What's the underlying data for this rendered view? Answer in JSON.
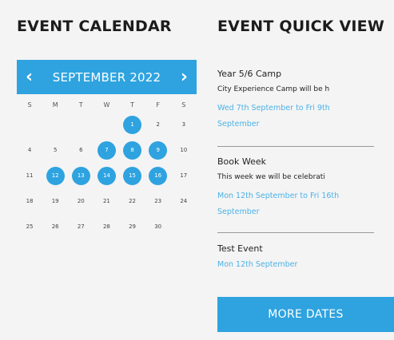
{
  "calendar": {
    "title": "EVENT CALENDAR",
    "prev_icon": "chevron-left-icon",
    "next_icon": "chevron-right-icon",
    "prev_glyph": "‹",
    "next_glyph": "›",
    "month": "SEPTEMBER 2022",
    "weekdays": [
      "S",
      "M",
      "T",
      "W",
      "T",
      "F",
      "S"
    ],
    "weeks": [
      [
        {
          "d": "",
          "e": false
        },
        {
          "d": "",
          "e": false
        },
        {
          "d": "",
          "e": false
        },
        {
          "d": "",
          "e": false
        },
        {
          "d": "1",
          "e": true
        },
        {
          "d": "2",
          "e": false
        },
        {
          "d": "3",
          "e": false
        }
      ],
      [
        {
          "d": "4",
          "e": false
        },
        {
          "d": "5",
          "e": false
        },
        {
          "d": "6",
          "e": false
        },
        {
          "d": "7",
          "e": true
        },
        {
          "d": "8",
          "e": true
        },
        {
          "d": "9",
          "e": true
        },
        {
          "d": "10",
          "e": false
        }
      ],
      [
        {
          "d": "11",
          "e": false
        },
        {
          "d": "12",
          "e": true
        },
        {
          "d": "13",
          "e": true
        },
        {
          "d": "14",
          "e": true
        },
        {
          "d": "15",
          "e": true
        },
        {
          "d": "16",
          "e": true
        },
        {
          "d": "17",
          "e": false
        }
      ],
      [
        {
          "d": "18",
          "e": false
        },
        {
          "d": "19",
          "e": false
        },
        {
          "d": "20",
          "e": false
        },
        {
          "d": "21",
          "e": false
        },
        {
          "d": "22",
          "e": false
        },
        {
          "d": "23",
          "e": false
        },
        {
          "d": "24",
          "e": false
        }
      ],
      [
        {
          "d": "25",
          "e": false
        },
        {
          "d": "26",
          "e": false
        },
        {
          "d": "27",
          "e": false
        },
        {
          "d": "28",
          "e": false
        },
        {
          "d": "29",
          "e": false
        },
        {
          "d": "30",
          "e": false
        },
        {
          "d": "",
          "e": false
        }
      ]
    ]
  },
  "quick_view": {
    "title": "EVENT QUICK VIEW",
    "events": [
      {
        "title": "Year 5/6 Camp",
        "description": "City Experience Camp will be h",
        "date": "Wed 7th September to Fri 9th September"
      },
      {
        "title": "Book Week",
        "description": "This week we will be celebrati",
        "date": "Mon 12th September to Fri 16th September"
      },
      {
        "title": "Test Event",
        "description": "",
        "date": "Mon 12th September"
      }
    ],
    "more_label": "MORE DATES"
  },
  "colors": {
    "accent": "#2ea3e0",
    "link": "#4bb2e6",
    "background": "#f4f4f4"
  }
}
